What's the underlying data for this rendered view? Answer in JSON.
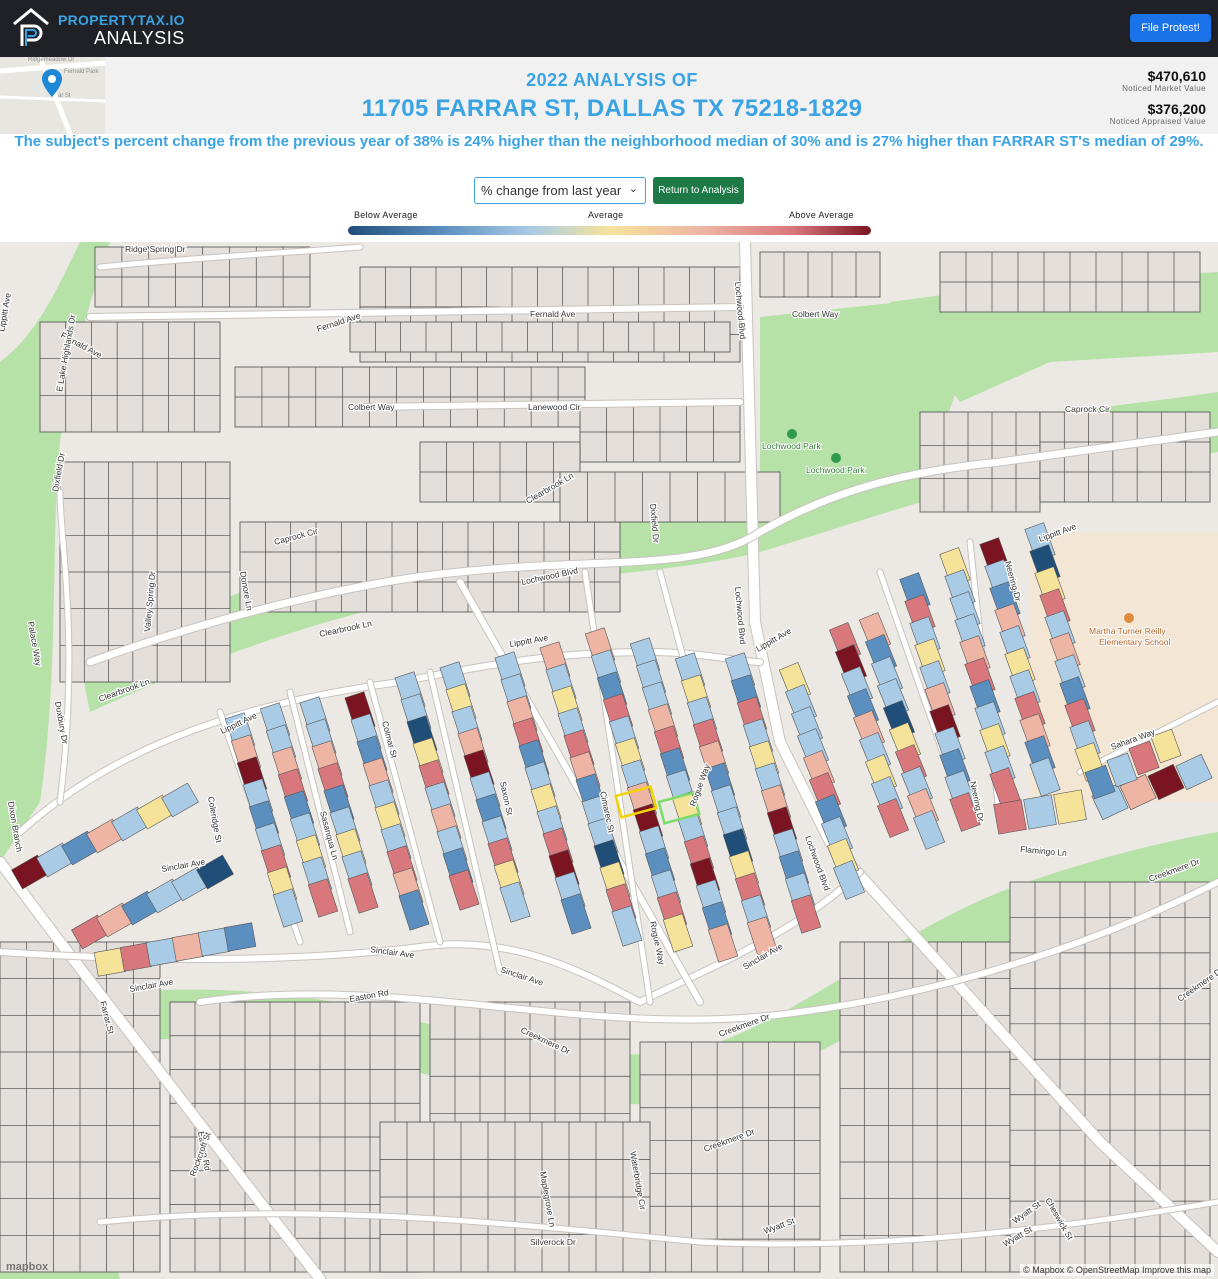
{
  "brand": {
    "line1": "PROPERTYTAX.IO",
    "line2": "ANALYSIS"
  },
  "header": {
    "subtitle": "2022 ANALYSIS OF",
    "address": "11705 FARRAR ST, DALLAS TX 75218-1829",
    "market_value": "$470,610",
    "market_label": "Noticed Market Value",
    "appraised_value": "$376,200",
    "appraised_label": "Noticed Appraised Value",
    "minimap_streets": [
      "Ridgemeadow Dr",
      "Fernald Park",
      "ar St"
    ]
  },
  "actions": {
    "file_protest": "File Protest!",
    "return": "Return to Analysis"
  },
  "summary": "The subject's percent change from the previous year of 38% is 24% higher than the neighborhood median of 30% and is 27% higher than FARRAR ST's median of 29%.",
  "metric_select": {
    "value": "% change from last year"
  },
  "legend": {
    "low": "Below Average",
    "mid": "Average",
    "high": "Above Average"
  },
  "colors": {
    "accent": "#3aa3e3",
    "protest_btn": "#1a73e8",
    "return_btn": "#1d7a46",
    "park": "#b6e2a8",
    "road": "#ffffff",
    "land": "#ece8e4",
    "scale": [
      "#1f4e79",
      "#5b8fc0",
      "#a9cbe6",
      "#f6e39a",
      "#eeb4a4",
      "#d9787c",
      "#7a1420"
    ]
  },
  "map": {
    "street_labels": [
      "Ridge Spring Dr",
      "Fernald Ave",
      "Fernald Ave",
      "Fernald Ave",
      "Colbert Way",
      "Colbert Way",
      "Lanewood Cir",
      "Caprock Cir",
      "Caprock Cir",
      "Clearbrook Ln",
      "Clearbrook Ln",
      "Clearbrook Ln",
      "Lochwood Blvd",
      "Lochwood Blvd",
      "Lochwood Blvd",
      "Lochwood Blvd",
      "Cheswick St",
      "Dixfield Dr",
      "Dixfield Dr",
      "Duxbury Dr",
      "Donore Ln",
      "Valley Spring Dr",
      "E Lake Highlands Dr",
      "Lippitt Ave",
      "Lippitt Ave",
      "Lippitt Ave",
      "Lippitt Ave",
      "Lippitt Ave",
      "Neering Dr",
      "Neering Dr",
      "Sahara Way",
      "Flamingo Ln",
      "Sinclair Ave",
      "Sinclair Ave",
      "Sinclair Ave",
      "Sinclair Ave",
      "Sinclair Ave",
      "Coleridge St",
      "Sasanqua Ln",
      "Colmar St",
      "Saxon St",
      "Cimarec St",
      "Rogue Way",
      "Rogue Way",
      "Farrar St",
      "Easton Rd",
      "Easton Rd",
      "Creekmere Dr",
      "Creekmere Dr",
      "Creekmere Dr",
      "Creekmere Dr",
      "Creekmere Dr",
      "Waterbridge Cir",
      "Maplegrove Ln",
      "Rockcroft St",
      "Silverock Dr",
      "Wyatt St",
      "Wyatt St",
      "Wyatt St",
      "Palace Way",
      "Dixon Branch",
      "Dixon Branch"
    ],
    "poi": [
      "Lochwood Park",
      "Lochwood Park",
      "Martha Turner Reilly Elementary School"
    ],
    "attribution": "© Mapbox © OpenStreetMap  Improve this map",
    "logo": "mapbox"
  }
}
